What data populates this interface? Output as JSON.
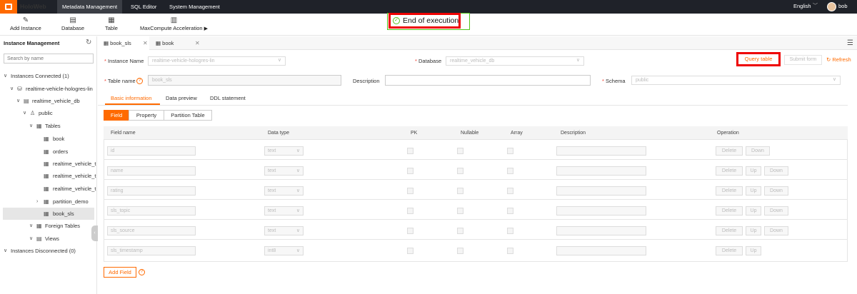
{
  "app": {
    "name": "HoloWeb"
  },
  "topnav": {
    "items": [
      "Metadata Management",
      "SQL Editor",
      "System Management"
    ],
    "active_index": 0,
    "language": "English",
    "user": "bob"
  },
  "toolbar": {
    "add_instance": "Add Instance",
    "database": "Database",
    "table": "Table",
    "maxcompute": "MaxCompute Acceleration"
  },
  "toast": {
    "message": "End of execution"
  },
  "sidebar": {
    "title": "Instance Management",
    "search_placeholder": "Search by name",
    "connected": "Instances Connected (1)",
    "instance": "realtime-vehicle-hologres-lin",
    "database": "realtime_vehicle_db",
    "schema": "public",
    "tables_label": "Tables",
    "tables": [
      "book",
      "orders",
      "realtime_vehicle_t",
      "realtime_vehicle_t",
      "realtime_vehicle_t",
      "partition_demo",
      "book_sls"
    ],
    "foreign_tables": "Foreign Tables",
    "views": "Views",
    "disconnected": "Instances Disconnected (0)"
  },
  "tabs": [
    {
      "label": "book_sls",
      "active": true
    },
    {
      "label": "book",
      "active": false
    }
  ],
  "form": {
    "instance_label": "Instance Name",
    "instance_value": "realtime-vehicle-hologres-lin",
    "database_label": "Database",
    "database_value": "realtime_vehicle_db",
    "table_label": "Table name",
    "table_value": "book_sls",
    "description_label": "Description",
    "description_value": "",
    "schema_label": "Schema",
    "schema_value": "public",
    "query_table": "Query table",
    "submit_form": "Submit form",
    "refresh": "Refresh"
  },
  "subtabs": [
    "Basic information",
    "Data preview",
    "DDL statement"
  ],
  "segments": [
    "Field",
    "Property",
    "Partition Table"
  ],
  "table": {
    "headers": [
      "Field name",
      "Data type",
      "PK",
      "Nullable",
      "Array",
      "Description",
      "Operation"
    ],
    "rows": [
      {
        "name": "id",
        "type": "text",
        "ops": [
          "Delete",
          "Down"
        ]
      },
      {
        "name": "name",
        "type": "text",
        "ops": [
          "Delete",
          "Up",
          "Down"
        ]
      },
      {
        "name": "rating",
        "type": "text",
        "ops": [
          "Delete",
          "Up",
          "Down"
        ]
      },
      {
        "name": "sls_topic",
        "type": "text",
        "ops": [
          "Delete",
          "Up",
          "Down"
        ]
      },
      {
        "name": "sls_source",
        "type": "text",
        "ops": [
          "Delete",
          "Up",
          "Down"
        ]
      },
      {
        "name": "sls_timestamp",
        "type": "int8",
        "ops": [
          "Delete",
          "Up"
        ]
      }
    ],
    "add_field": "Add Field"
  },
  "colors": {
    "accent": "#ff6a00",
    "topbar": "#1f2229",
    "success": "#52c41a"
  }
}
